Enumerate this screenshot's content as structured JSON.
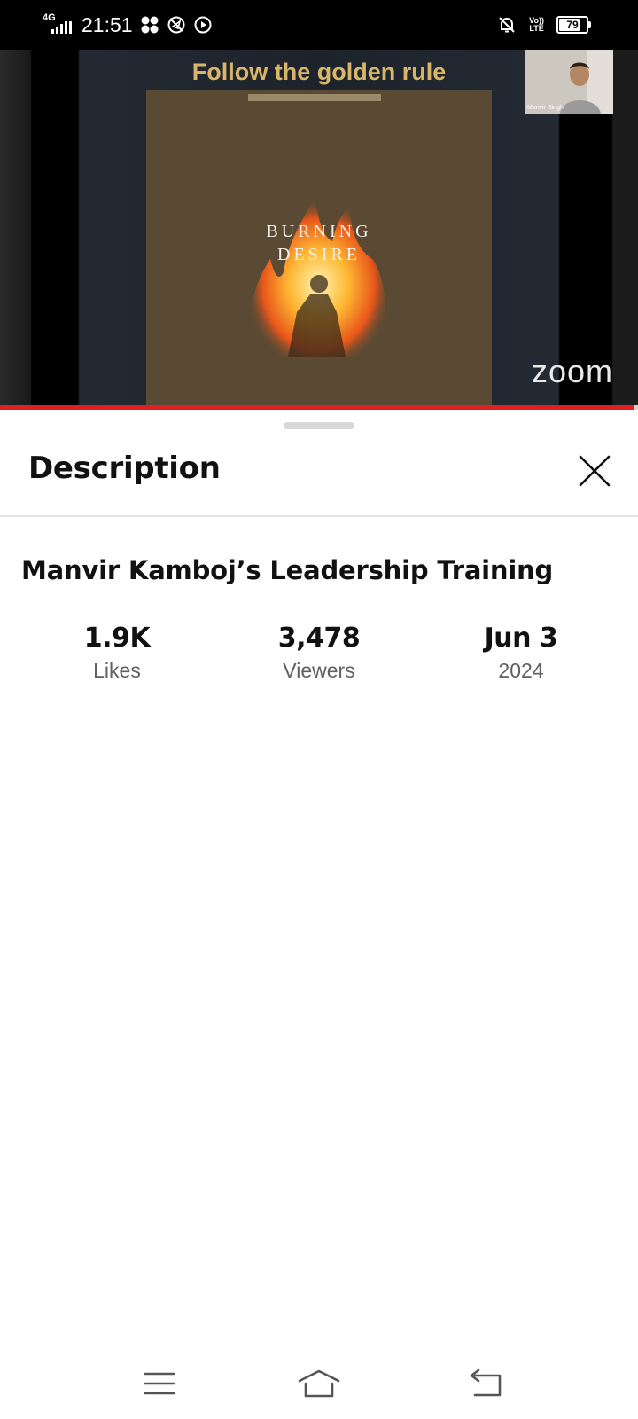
{
  "status_bar": {
    "network_type": "4G",
    "time": "21:51",
    "volte_top": "Vo))",
    "volte_bottom": "LTE",
    "battery": "79",
    "battery_level": 0.79,
    "icons": [
      "signal-icon",
      "pinwheel-icon",
      "no-location-icon",
      "play-circle-icon",
      "bell-off-icon",
      "volte-icon",
      "battery-icon"
    ]
  },
  "video": {
    "slide_title": "Follow the golden rule",
    "book_line1": "BURNING",
    "book_line2": "DESIRE",
    "presenter_label": "Manvir Singh",
    "watermark": "zoom",
    "progress_fraction": 0.995,
    "progress_color": "#e02020"
  },
  "sheet": {
    "title": "Description",
    "close_icon": "close-icon",
    "video_title": "Manvir Kamboj’s Leadership Training",
    "stats": [
      {
        "value": "1.9K",
        "label": "Likes"
      },
      {
        "value": "3,478",
        "label": "Viewers"
      },
      {
        "value": "Jun 3",
        "label": "2024"
      }
    ]
  },
  "nav_bar": {
    "icons": [
      "menu-icon",
      "home-icon",
      "back-icon"
    ]
  }
}
